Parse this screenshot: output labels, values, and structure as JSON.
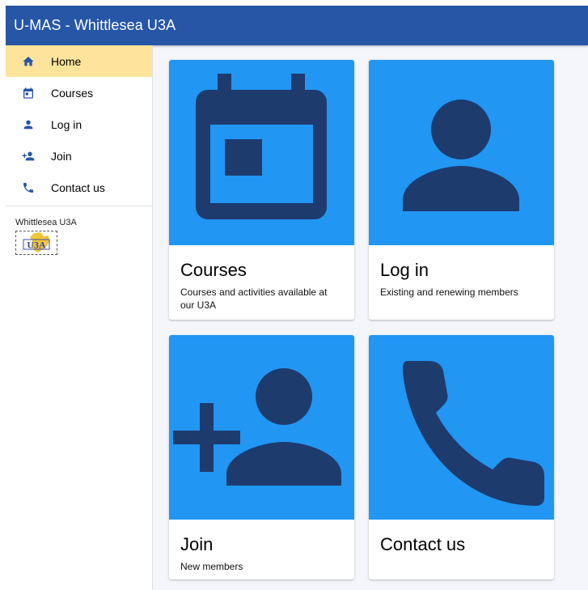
{
  "app": {
    "title": "U-MAS - Whittlesea U3A"
  },
  "nav": {
    "items": [
      {
        "label": "Home",
        "icon": "home-icon",
        "active": true
      },
      {
        "label": "Courses",
        "icon": "calendar-icon",
        "active": false
      },
      {
        "label": "Log in",
        "icon": "person-icon",
        "active": false
      },
      {
        "label": "Join",
        "icon": "person-add-icon",
        "active": false
      },
      {
        "label": "Contact us",
        "icon": "phone-icon",
        "active": false
      }
    ],
    "org_name": "Whittlesea U3A",
    "logo_text": "U3A"
  },
  "cards": [
    {
      "title": "Courses",
      "description": "Courses and activities available at our U3A",
      "icon": "calendar-icon"
    },
    {
      "title": "Log in",
      "description": "Existing and renewing members",
      "icon": "person-icon"
    },
    {
      "title": "Join",
      "description": "New members",
      "icon": "person-add-icon"
    },
    {
      "title": "Contact us",
      "description": "",
      "icon": "phone-icon"
    }
  ],
  "colors": {
    "appbar": "#2756a7",
    "active_nav": "#fde49a",
    "card_media": "#2196f3",
    "icon_dark": "#1e3b6e",
    "nav_icon": "#2756a7"
  }
}
